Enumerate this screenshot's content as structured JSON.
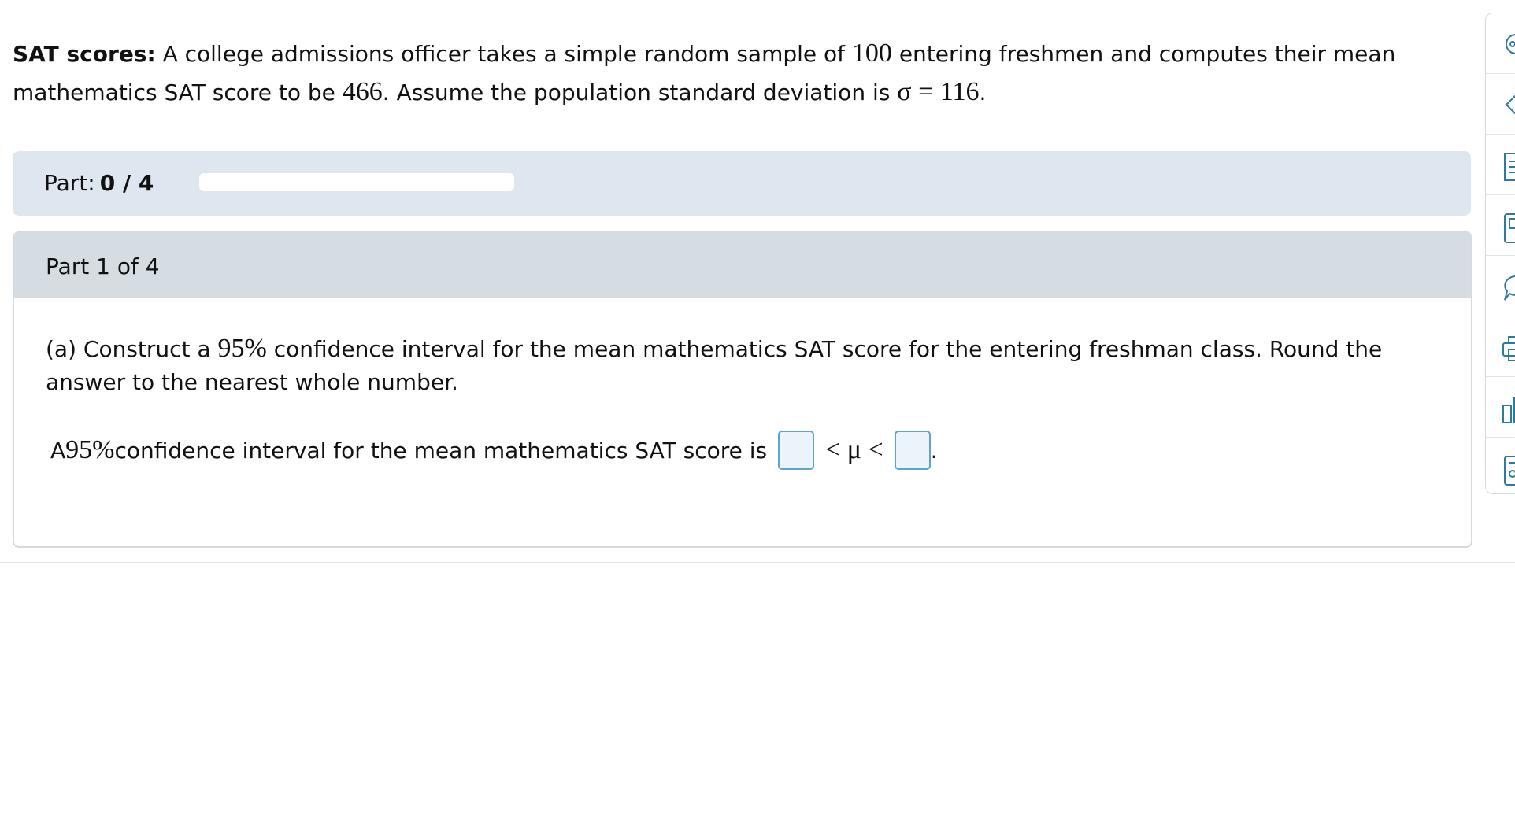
{
  "problem": {
    "lead": "SAT scores:",
    "t1": " A college admissions officer takes a simple random sample of ",
    "n": "100",
    "t2": " entering freshmen and computes their mean mathematics SAT score to be ",
    "mean": "466",
    "t3": ". Assume the population standard deviation is ",
    "sigma_expr": "σ = 116",
    "t4": "."
  },
  "progress": {
    "label": "Part:",
    "count": "0 / 4",
    "completed_fraction": 0
  },
  "part": {
    "title": "Part 1 of 4",
    "question_prefix": "(a) Construct a ",
    "question_pct": "95%",
    "question_suffix": " confidence interval for the mean mathematics SAT score for the entering freshman class. Round the answer to the nearest whole number.",
    "answer_prefix": "A ",
    "answer_pct": "95%",
    "answer_middle": " confidence interval for the mean mathematics SAT score is ",
    "inequality": "< μ <",
    "answer_end": "."
  },
  "sidebar": {
    "icons": [
      "read-aloud-icon",
      "highlighter-icon",
      "notes-icon",
      "ebook-icon",
      "ask-question-icon",
      "print-icon",
      "data-icon",
      "calculator-icon"
    ]
  },
  "colors": {
    "progress_panel_bg": "#dee7f0",
    "part_header_bg": "#d5dde2",
    "answer_box_border": "#5fa4c7",
    "answer_box_bg": "#eaf4fa",
    "icon_color": "#2e7b9e"
  }
}
